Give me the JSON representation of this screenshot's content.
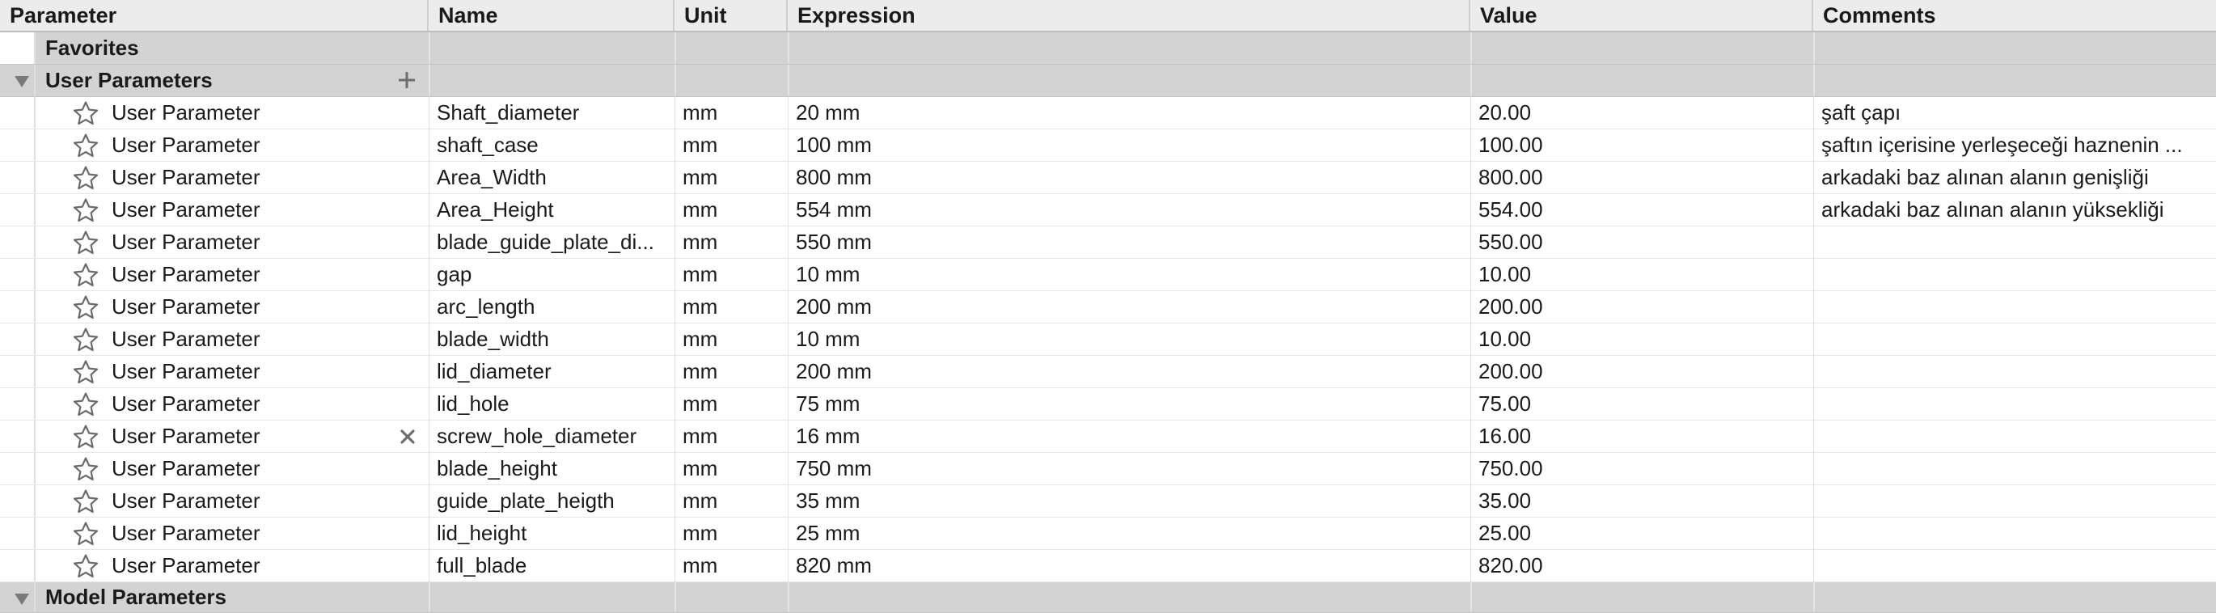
{
  "columns": {
    "parameter": "Parameter",
    "name": "Name",
    "unit": "Unit",
    "expression": "Expression",
    "value": "Value",
    "comments": "Comments"
  },
  "groups": {
    "favorites": "Favorites",
    "user_parameters": "User Parameters",
    "model_parameters": "Model Parameters"
  },
  "rows": [
    {
      "parameter": "User Parameter",
      "name": "Shaft_diameter",
      "unit": "mm",
      "expression": "20 mm",
      "value": "20.00",
      "comment": "şaft çapı"
    },
    {
      "parameter": "User Parameter",
      "name": "shaft_case",
      "unit": "mm",
      "expression": "100 mm",
      "value": "100.00",
      "comment": "şaftın içerisine yerleşeceği haznenin ..."
    },
    {
      "parameter": "User Parameter",
      "name": "Area_Width",
      "unit": "mm",
      "expression": "800 mm",
      "value": "800.00",
      "comment": "arkadaki baz alınan alanın genişliği"
    },
    {
      "parameter": "User Parameter",
      "name": "Area_Height",
      "unit": "mm",
      "expression": "554 mm",
      "value": "554.00",
      "comment": "arkadaki baz alınan alanın yüksekliği"
    },
    {
      "parameter": "User Parameter",
      "name": "blade_guide_plate_di...",
      "unit": "mm",
      "expression": "550 mm",
      "value": "550.00",
      "comment": ""
    },
    {
      "parameter": "User Parameter",
      "name": "gap",
      "unit": "mm",
      "expression": "10 mm",
      "value": "10.00",
      "comment": ""
    },
    {
      "parameter": "User Parameter",
      "name": "arc_length",
      "unit": "mm",
      "expression": "200 mm",
      "value": "200.00",
      "comment": ""
    },
    {
      "parameter": "User Parameter",
      "name": "blade_width",
      "unit": "mm",
      "expression": "10 mm",
      "value": "10.00",
      "comment": ""
    },
    {
      "parameter": "User Parameter",
      "name": "lid_diameter",
      "unit": "mm",
      "expression": "200 mm",
      "value": "200.00",
      "comment": ""
    },
    {
      "parameter": "User Parameter",
      "name": "lid_hole",
      "unit": "mm",
      "expression": "75 mm",
      "value": "75.00",
      "comment": ""
    },
    {
      "parameter": "User Parameter",
      "name": "screw_hole_diameter",
      "unit": "mm",
      "expression": "16 mm",
      "value": "16.00",
      "comment": "",
      "delete_icon": true
    },
    {
      "parameter": "User Parameter",
      "name": "blade_height",
      "unit": "mm",
      "expression": "750 mm",
      "value": "750.00",
      "comment": ""
    },
    {
      "parameter": "User Parameter",
      "name": "guide_plate_heigth",
      "unit": "mm",
      "expression": "35 mm",
      "value": "35.00",
      "comment": ""
    },
    {
      "parameter": "User Parameter",
      "name": "lid_height",
      "unit": "mm",
      "expression": "25 mm",
      "value": "25.00",
      "comment": ""
    },
    {
      "parameter": "User Parameter",
      "name": "full_blade",
      "unit": "mm",
      "expression": "820 mm",
      "value": "820.00",
      "comment": ""
    }
  ],
  "icons": {
    "favorite": "star-outline-icon",
    "expand": "triangle-down-icon",
    "add": "plus-icon",
    "delete": "x-icon"
  }
}
